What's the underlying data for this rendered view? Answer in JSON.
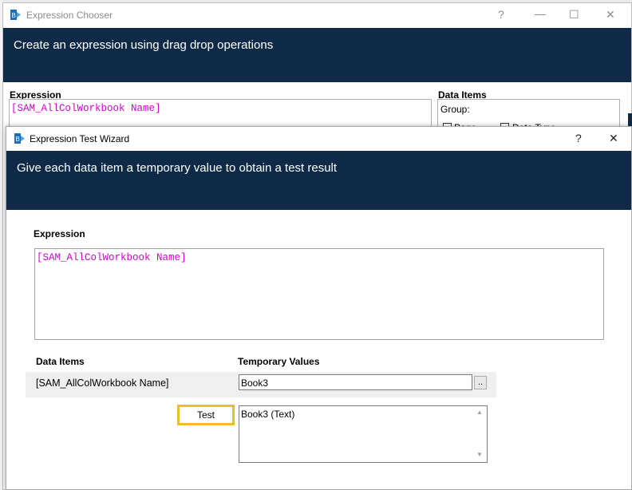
{
  "background_window": {
    "title": "Expression Chooser",
    "banner": "Create an expression using drag drop operations",
    "expression_label": "Expression",
    "expression_value": "[SAM_AllColWorkbook Name]",
    "data_items_label": "Data Items",
    "group_label": "Group:",
    "checkbox_page_label": "Page",
    "checkbox_datatype_label": "Data Type",
    "controls": {
      "help": "?",
      "minimize": "—",
      "maximize": "☐",
      "close": "✕"
    }
  },
  "dialog": {
    "title": "Expression Test Wizard",
    "banner": "Give each data item a temporary value to obtain a test result",
    "controls": {
      "help": "?",
      "close": "✕"
    },
    "expression_label": "Expression",
    "expression_value": "[SAM_AllColWorkbook Name]",
    "data_items_header": "Data Items",
    "temp_values_header": "Temporary Values",
    "rows": [
      {
        "item": "[SAM_AllColWorkbook Name]",
        "value": "Book3",
        "browse_label": ".."
      }
    ],
    "test_button": "Test",
    "result": "Book3 (Text)"
  },
  "colors": {
    "banner": "#0e2a47",
    "expression_text": "#d000d0",
    "test_highlight": "#f0bb2a"
  },
  "icons": [
    "app-logo-icon",
    "help-icon",
    "minimize-icon",
    "maximize-icon",
    "close-icon",
    "scroll-up-icon",
    "scroll-down-icon"
  ]
}
